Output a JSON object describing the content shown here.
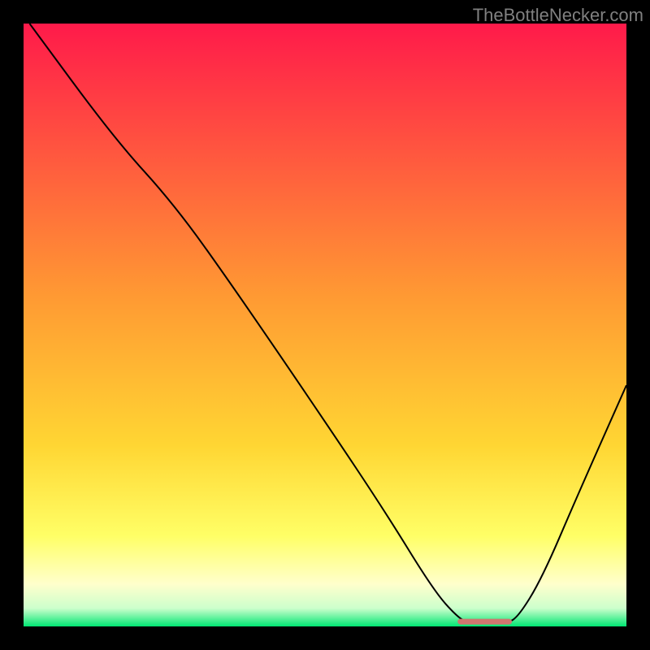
{
  "watermark": "TheBottleNecker.com",
  "chart_data": {
    "type": "line",
    "title": "",
    "xlabel": "",
    "ylabel": "",
    "x_range": [
      0,
      100
    ],
    "y_range": [
      0,
      100
    ],
    "gradient_stops": [
      {
        "offset": 0,
        "color": "#ff1a4a"
      },
      {
        "offset": 45,
        "color": "#ff9933"
      },
      {
        "offset": 70,
        "color": "#ffd633"
      },
      {
        "offset": 85,
        "color": "#ffff66"
      },
      {
        "offset": 93,
        "color": "#ffffcc"
      },
      {
        "offset": 97,
        "color": "#ccffcc"
      },
      {
        "offset": 100,
        "color": "#00e673"
      }
    ],
    "curve_points": [
      {
        "x": 1,
        "y": 100
      },
      {
        "x": 15,
        "y": 81
      },
      {
        "x": 25,
        "y": 70
      },
      {
        "x": 35,
        "y": 56
      },
      {
        "x": 50,
        "y": 34
      },
      {
        "x": 60,
        "y": 19
      },
      {
        "x": 68,
        "y": 6
      },
      {
        "x": 72,
        "y": 1.5
      },
      {
        "x": 74,
        "y": 0.5
      },
      {
        "x": 80,
        "y": 0.5
      },
      {
        "x": 82,
        "y": 1.5
      },
      {
        "x": 86,
        "y": 8
      },
      {
        "x": 92,
        "y": 22
      },
      {
        "x": 100,
        "y": 40
      }
    ],
    "marker": {
      "x_start": 72,
      "x_end": 81,
      "y": 0.8,
      "color": "#d0766f"
    },
    "curve_color": "#000000",
    "curve_width": 2
  }
}
